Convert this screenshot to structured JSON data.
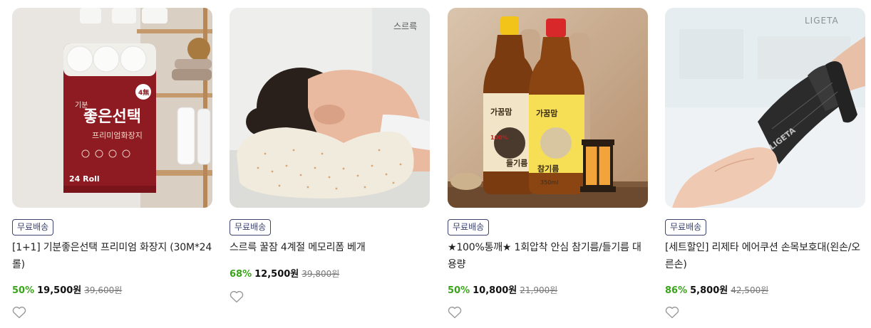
{
  "products": [
    {
      "badge": "무료배송",
      "title": "[1+1] 기분좋은선택 프리미엄 화장지 (30M*24롤)",
      "discount": "50%",
      "price": "19,500원",
      "original_price": "39,600원",
      "image_text": {
        "brand_small": "기분",
        "brand_big": "좋은선택",
        "sub": "프리미엄화장지",
        "count": "24 Roll",
        "tag": "4無"
      }
    },
    {
      "badge": "무료배송",
      "title": "스르륵 꿀잠 4계절 메모리폼 베개",
      "discount": "68%",
      "price": "12,500원",
      "original_price": "39,800원",
      "image_text": {
        "logo": "스르륵"
      }
    },
    {
      "badge": "무료배송",
      "title": "★100%통깨★ 1회압착 안심 참기름/들기름 대용량",
      "discount": "50%",
      "price": "10,800원",
      "original_price": "21,900원",
      "image_text": {
        "left_label": "들기름",
        "right_label": "참기름",
        "percent": "100%",
        "volume": "350ml"
      }
    },
    {
      "badge": "무료배송",
      "title": "[세트할인] 리제타 에어쿠션 손목보호대(왼손/오른손)",
      "discount": "86%",
      "price": "5,800원",
      "original_price": "42,500원",
      "image_text": {
        "logo": "LIGETA"
      }
    }
  ],
  "colors": {
    "badge_border": "#3d4470",
    "discount": "#3aa41a",
    "heart_stroke": "#9a9a9a"
  },
  "icons": {
    "wishlist": "heart-outline-icon"
  }
}
